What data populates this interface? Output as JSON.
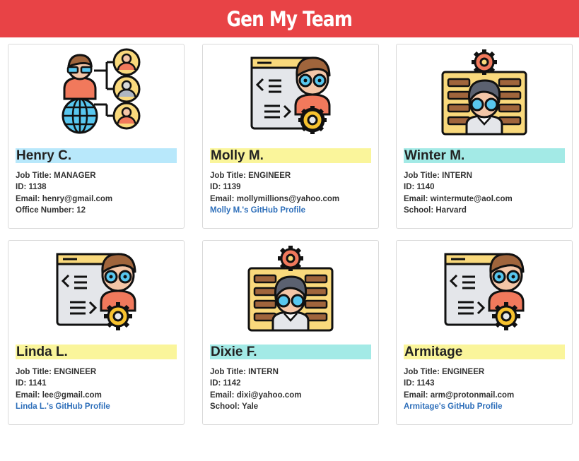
{
  "header": {
    "title": "Gen My Team"
  },
  "labels": {
    "job_title": "Job Title: ",
    "id": "ID: ",
    "email": "Email: ",
    "office": "Office Number: ",
    "school": "School: "
  },
  "colors": {
    "header_bg": "#e84346",
    "highlight_manager": "#b8e8fb",
    "highlight_engineer": "#faf59b",
    "highlight_intern": "#a3eae6",
    "link": "#2e6fba"
  },
  "employees": [
    {
      "name": "Henry C.",
      "role": "MANAGER",
      "id": "1138",
      "email": "henry@gmail.com",
      "office": "12",
      "icon": "manager-network-icon"
    },
    {
      "name": "Molly M.",
      "role": "ENGINEER",
      "id": "1139",
      "email": "mollymillions@yahoo.com",
      "github_label": "Molly M.'s GitHub Profile",
      "icon": "engineer-coder-icon"
    },
    {
      "name": "Winter M.",
      "role": "INTERN",
      "id": "1140",
      "email": "wintermute@aol.com",
      "school": "Harvard",
      "icon": "intern-student-icon"
    },
    {
      "name": "Linda L.",
      "role": "ENGINEER",
      "id": "1141",
      "email": "lee@gmail.com",
      "github_label": "Linda L.'s GitHub Profile",
      "icon": "engineer-coder-icon"
    },
    {
      "name": "Dixie F.",
      "role": "INTERN",
      "id": "1142",
      "email": "dixi@yahoo.com",
      "school": "Yale",
      "icon": "intern-student-icon"
    },
    {
      "name": "Armitage",
      "role": "ENGINEER",
      "id": "1143",
      "email": "arm@protonmail.com",
      "github_label": "Armitage's GitHub Profile",
      "icon": "engineer-coder-icon"
    }
  ]
}
